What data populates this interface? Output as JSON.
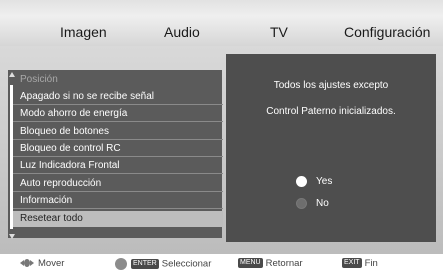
{
  "tabs": [
    "Imagen",
    "Audio",
    "TV",
    "Configuración"
  ],
  "menu": {
    "items": [
      {
        "label": "Posición",
        "state": "disabled"
      },
      {
        "label": "Apagado si no se recibe señal",
        "state": "normal"
      },
      {
        "label": "Modo ahorro de energía",
        "state": "normal"
      },
      {
        "label": "Bloqueo de botones",
        "state": "normal"
      },
      {
        "label": "Bloqueo de control RC",
        "state": "normal"
      },
      {
        "label": "Luz Indicadora Frontal",
        "state": "normal"
      },
      {
        "label": "Auto reproducción",
        "state": "normal"
      },
      {
        "label": "Información",
        "state": "normal"
      },
      {
        "label": "Resetear todo",
        "state": "selected"
      }
    ]
  },
  "dialog": {
    "line1": "Todos los ajustes excepto",
    "line2": "Control Paterno inicializados.",
    "options": [
      {
        "label": "Yes",
        "selected": true
      },
      {
        "label": "No",
        "selected": false
      }
    ]
  },
  "footer": {
    "move": "Mover",
    "enter_key": "ENTER",
    "select": "Seleccionar",
    "menu_key": "MENU",
    "back": "Retornar",
    "exit_key": "EXIT",
    "end": "Fin"
  },
  "colors": {
    "panel": "#5b5b5b",
    "dialog": "#4e4e4e",
    "selected_row": "#bdbdbd",
    "screen": "#c8c8c8"
  }
}
